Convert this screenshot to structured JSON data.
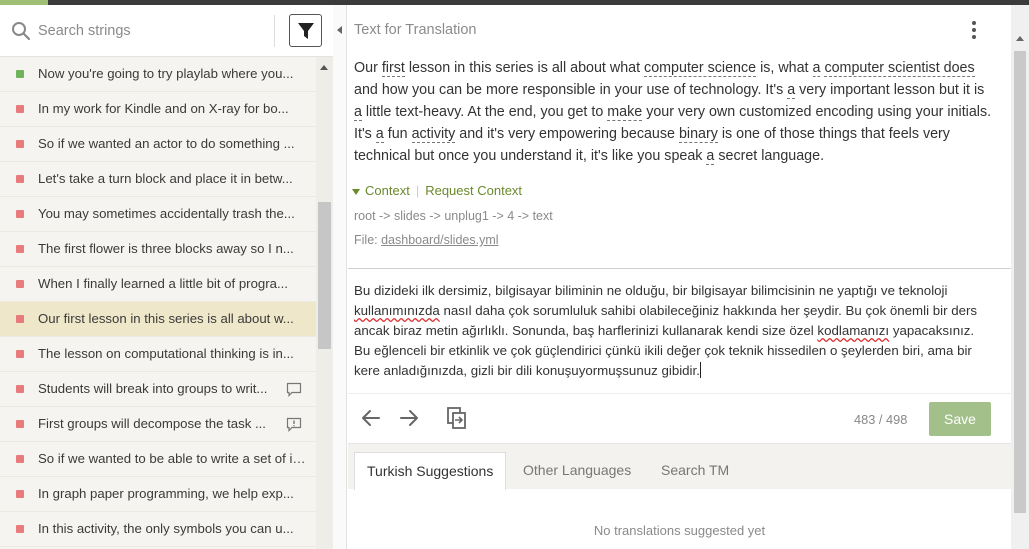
{
  "colors": {
    "accent_green": "#9fbf74",
    "context_green": "#6a8a2c",
    "error_dot": "#e87c7c",
    "ok_dot": "#6fb35a",
    "selected_bg": "#efe7c9",
    "save_bg": "#a3c08a"
  },
  "search": {
    "placeholder": "Search strings",
    "icon": "search-icon",
    "filter_icon": "filter-icon"
  },
  "strings": [
    {
      "text": "Now you're going to try playlab where you...",
      "status": "translated"
    },
    {
      "text": "In my work for Kindle and on X-ray for bo...",
      "status": "untranslated"
    },
    {
      "text": "So if we wanted an actor to do something ...",
      "status": "untranslated"
    },
    {
      "text": "Let's take a turn block and place it in betw...",
      "status": "untranslated"
    },
    {
      "text": "You may sometimes accidentally trash the...",
      "status": "untranslated"
    },
    {
      "text": "The first flower is three blocks away so I n...",
      "status": "untranslated"
    },
    {
      "text": "When I finally learned a little bit of progra...",
      "status": "untranslated"
    },
    {
      "text": "Our first lesson in this series is all about w...",
      "status": "untranslated",
      "selected": true
    },
    {
      "text": "The lesson on computational thinking is in...",
      "status": "untranslated"
    },
    {
      "text": "Students will break into groups to writ...",
      "status": "untranslated",
      "icon": "comment-icon"
    },
    {
      "text": "First groups will decompose the task ...",
      "status": "untranslated",
      "icon": "comment-alert-icon"
    },
    {
      "text": "So if we wanted to be able to write a set of in...",
      "status": "untranslated"
    },
    {
      "text": "In graph paper programming, we help exp...",
      "status": "untranslated"
    },
    {
      "text": "In this activity, the only symbols you can u...",
      "status": "untranslated"
    }
  ],
  "editor": {
    "title": "Text for Translation",
    "source_segments": [
      {
        "t": "Our ",
        "u": false
      },
      {
        "t": "first",
        "u": true
      },
      {
        "t": " lesson in this series is all about what ",
        "u": false
      },
      {
        "t": "computer science",
        "u": true
      },
      {
        "t": " is, what ",
        "u": false
      },
      {
        "t": "a",
        "u": true
      },
      {
        "t": " ",
        "u": false
      },
      {
        "t": "computer scientist does",
        "u": true
      },
      {
        "t": " and how you can be more responsible in your use of technology. It's ",
        "u": false
      },
      {
        "t": "a",
        "u": true
      },
      {
        "t": " very important lesson but it is ",
        "u": false
      },
      {
        "t": "a",
        "u": true
      },
      {
        "t": " little text-heavy. At the end, you get to ",
        "u": false
      },
      {
        "t": "make",
        "u": true
      },
      {
        "t": " your very own customized encoding using your initials. It's ",
        "u": false
      },
      {
        "t": "a",
        "u": true
      },
      {
        "t": " fun ",
        "u": false
      },
      {
        "t": "activity",
        "u": true
      },
      {
        "t": " and it's very empowering because ",
        "u": false
      },
      {
        "t": "binary",
        "u": true
      },
      {
        "t": " is one of those things that feels very technical but once you understand it, it's like you speak ",
        "u": false
      },
      {
        "t": "a",
        "u": true
      },
      {
        "t": " secret language.",
        "u": false
      }
    ],
    "context_label": "Context",
    "request_context_label": "Request Context",
    "path": "root -> slides -> unplug1 -> 4 -> text",
    "file_prefix": "File: ",
    "file_link": "dashboard/slides.yml",
    "translation_segments": [
      {
        "t": "Bu dizideki ilk dersimiz, bilgisayar biliminin ne olduğu, bir bilgisayar bilimcisinin ne yaptığı ve teknoloji ",
        "s": false
      },
      {
        "t": "kullanımınızda",
        "s": true
      },
      {
        "t": " nasıl daha çok sorumluluk sahibi olabileceğiniz hakkında her şeydir. Bu çok önemli bir ders ancak biraz metin ağırlıklı. Sonunda, baş harflerinizi kullanarak kendi size özel ",
        "s": false
      },
      {
        "t": "kodlamanızı",
        "s": true
      },
      {
        "t": " yapacaksınız. Bu eğlenceli bir etkinlik ve çok güçlendirici çünkü ikili değer çok teknik hissedilen o şeylerden biri, ama bir kere anladığınızda, gizli bir dili konuşuyormuşsunuz gibidir.",
        "s": false
      }
    ],
    "counter": "483 / 498",
    "save_label": "Save"
  },
  "tabs": [
    {
      "label": "Turkish Suggestions",
      "active": true
    },
    {
      "label": "Other Languages",
      "active": false
    },
    {
      "label": "Search TM",
      "active": false
    }
  ],
  "no_suggestions": "No translations suggested yet"
}
